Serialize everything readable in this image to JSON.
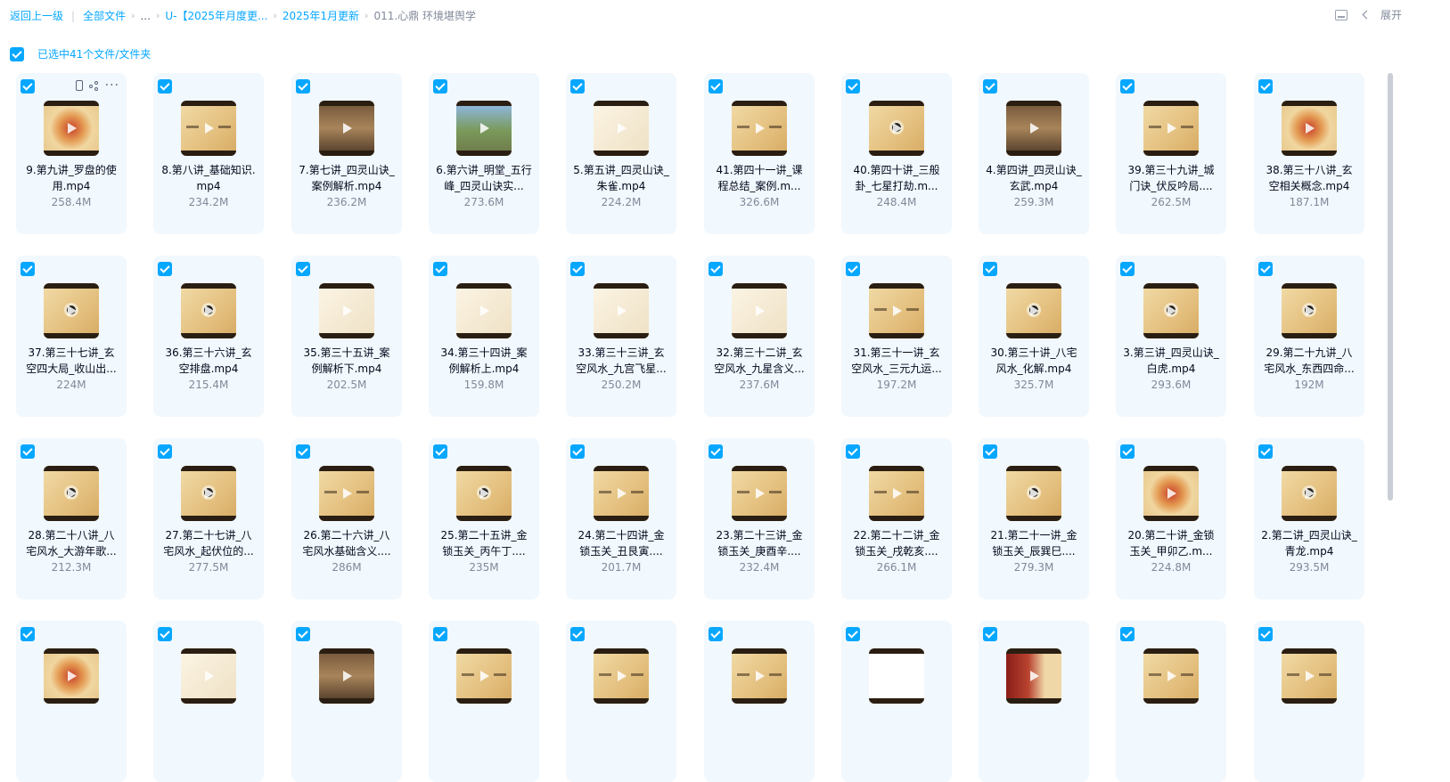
{
  "breadcrumb": {
    "back": "返回上一级",
    "all_files": "全部文件",
    "ellipsis": "...",
    "folder1": "U-【2025年月度更...",
    "folder2": "2025年1月更新",
    "current": "011.心鼎 环境堪舆学"
  },
  "toolbar": {
    "expand_label": "展开"
  },
  "selection": {
    "text": "已选中41个文件/文件夹"
  },
  "colors": {
    "accent": "#06a7ff",
    "card_bg": "#f1f8fe",
    "text": "#03081a",
    "muted": "#818999"
  },
  "files": [
    {
      "name": "9.第九讲_罗盘的使用.mp4",
      "size": "258.4M",
      "thumb": "compass"
    },
    {
      "name": "8.第八讲_基础知识.mp4",
      "size": "234.2M",
      "thumb": "paper"
    },
    {
      "name": "7.第七讲_四灵山诀_案例解析.mp4",
      "size": "236.2M",
      "thumb": "room"
    },
    {
      "name": "6.第六讲_明堂_五行峰_四灵山诀实...",
      "size": "273.6M",
      "thumb": "photo"
    },
    {
      "name": "5.第五讲_四灵山诀_朱雀.mp4",
      "size": "224.2M",
      "thumb": "diagram"
    },
    {
      "name": "41.第四十一讲_课程总结_案例.m...",
      "size": "326.6M",
      "thumb": "paper"
    },
    {
      "name": "40.第四十讲_三般卦_七星打劫.m...",
      "size": "248.4M",
      "thumb": "logo"
    },
    {
      "name": "4.第四讲_四灵山诀_玄武.mp4",
      "size": "259.3M",
      "thumb": "room"
    },
    {
      "name": "39.第三十九讲_城门诀_伏反吟局....",
      "size": "262.5M",
      "thumb": "paper"
    },
    {
      "name": "38.第三十八讲_玄空相关概念.mp4",
      "size": "187.1M",
      "thumb": "compass"
    },
    {
      "name": "37.第三十七讲_玄空四大局_收山出...",
      "size": "224M",
      "thumb": "logo"
    },
    {
      "name": "36.第三十六讲_玄空排盘.mp4",
      "size": "215.4M",
      "thumb": "logo"
    },
    {
      "name": "35.第三十五讲_案例解析下.mp4",
      "size": "202.5M",
      "thumb": "diagram"
    },
    {
      "name": "34.第三十四讲_案例解析上.mp4",
      "size": "159.8M",
      "thumb": "diagram"
    },
    {
      "name": "33.第三十三讲_玄空风水_九宫飞星...",
      "size": "250.2M",
      "thumb": "diagram"
    },
    {
      "name": "32.第三十二讲_玄空风水_九星含义...",
      "size": "237.6M",
      "thumb": "diagram"
    },
    {
      "name": "31.第三十一讲_玄空风水_三元九运...",
      "size": "197.2M",
      "thumb": "paper"
    },
    {
      "name": "30.第三十讲_八宅风水_化解.mp4",
      "size": "325.7M",
      "thumb": "logo"
    },
    {
      "name": "3.第三讲_四灵山诀_白虎.mp4",
      "size": "293.6M",
      "thumb": "logo"
    },
    {
      "name": "29.第二十九讲_八宅风水_东西四命...",
      "size": "192M",
      "thumb": "logo"
    },
    {
      "name": "28.第二十八讲_八宅风水_大游年歌...",
      "size": "212.3M",
      "thumb": "logo"
    },
    {
      "name": "27.第二十七讲_八宅风水_起伏位的...",
      "size": "277.5M",
      "thumb": "logo"
    },
    {
      "name": "26.第二十六讲_八宅风水基础含义....",
      "size": "286M",
      "thumb": "paper"
    },
    {
      "name": "25.第二十五讲_金锁玉关_丙午丁....",
      "size": "235M",
      "thumb": "logo"
    },
    {
      "name": "24.第二十四讲_金锁玉关_丑艮寅....",
      "size": "201.7M",
      "thumb": "paper"
    },
    {
      "name": "23.第二十三讲_金锁玉关_庚酉辛....",
      "size": "232.4M",
      "thumb": "paper"
    },
    {
      "name": "22.第二十二讲_金锁玉关_戌乾亥....",
      "size": "266.1M",
      "thumb": "paper"
    },
    {
      "name": "21.第二十一讲_金锁玉关_辰巽巳....",
      "size": "279.3M",
      "thumb": "logo"
    },
    {
      "name": "20.第二十讲_金锁玉关_甲卯乙.m...",
      "size": "224.8M",
      "thumb": "compass"
    },
    {
      "name": "2.第二讲_四灵山诀_青龙.mp4",
      "size": "293.5M",
      "thumb": "logo"
    },
    {
      "name": "",
      "size": "",
      "thumb": "compass"
    },
    {
      "name": "",
      "size": "",
      "thumb": "diagram"
    },
    {
      "name": "",
      "size": "",
      "thumb": "room"
    },
    {
      "name": "",
      "size": "",
      "thumb": "paper"
    },
    {
      "name": "",
      "size": "",
      "thumb": "paper"
    },
    {
      "name": "",
      "size": "",
      "thumb": "paper"
    },
    {
      "name": "",
      "size": "",
      "thumb": "blank"
    },
    {
      "name": "",
      "size": "",
      "thumb": "red"
    },
    {
      "name": "",
      "size": "",
      "thumb": "paper"
    },
    {
      "name": "",
      "size": "",
      "thumb": "paper"
    }
  ]
}
